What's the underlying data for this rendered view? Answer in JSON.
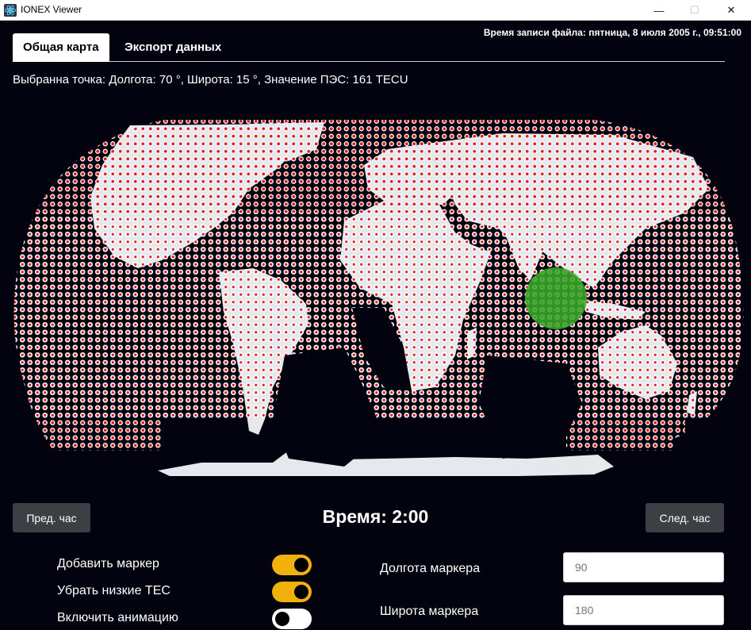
{
  "window": {
    "title": "IONEX Viewer",
    "minimize_symbol": "—",
    "maximize_symbol": "☐",
    "close_symbol": "✕"
  },
  "file_time": "Время записи файла: пятница, 8 июля 2005 г., 09:51:00",
  "tabs": [
    {
      "label": "Общая карта",
      "active": true
    },
    {
      "label": "Экспорт данных",
      "active": false
    }
  ],
  "selected_point": "Выбранна точка: Долгота: 70 °, Широта: 15 °, Значение ПЭС: 161 TECU",
  "map": {
    "land_color": "#e5e8ec",
    "dot_color": "#e41a1a",
    "dot_outline": "#ffffff",
    "marker_color": "#3aa82a",
    "background": "#02030f"
  },
  "controls": {
    "prev_label": "Пред. час",
    "next_label": "След. час",
    "time_title": "Время: 2:00"
  },
  "options": [
    {
      "label": "Добавить маркер",
      "on": true
    },
    {
      "label": "Убрать низкие TEC",
      "on": true
    },
    {
      "label": "Включить анимацию",
      "on": false
    }
  ],
  "marker_fields": {
    "lon_label": "Долгота маркера",
    "lon_value": "90",
    "lat_label": "Широта маркера",
    "lat_value": "180"
  },
  "colors": {
    "accent": "#f2b00a",
    "button": "#3d3f44"
  }
}
